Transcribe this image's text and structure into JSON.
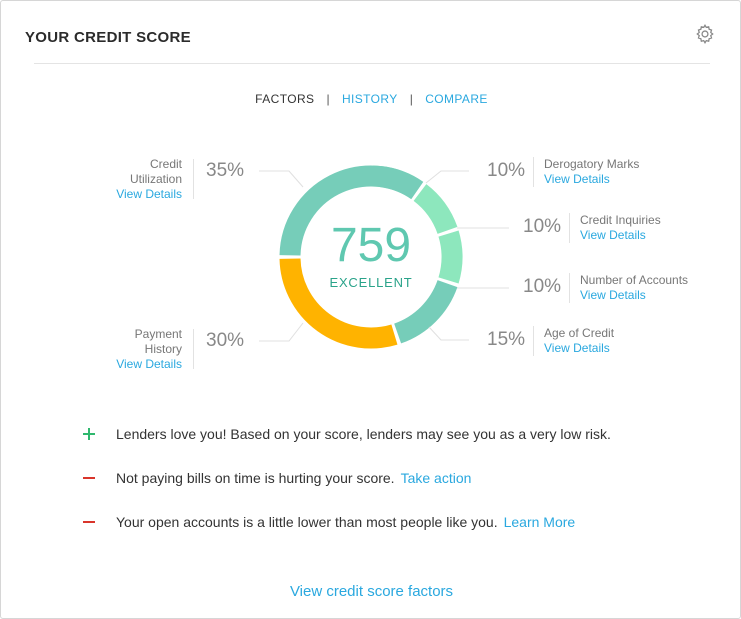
{
  "header": {
    "title": "YOUR CREDIT SCORE",
    "settings_icon": "gear-icon"
  },
  "tabs": [
    {
      "label": "FACTORS",
      "active": true
    },
    {
      "label": "HISTORY",
      "active": false
    },
    {
      "label": "COMPARE",
      "active": false
    }
  ],
  "tab_separator": "|",
  "score": {
    "value": "759",
    "rating": "EXCELLENT"
  },
  "colors": {
    "accent": "#2aa8df",
    "teal": "#76cdb9",
    "light_green": "#8de7bd",
    "orange": "#ffb300",
    "positive": "#2fb86e",
    "negative": "#d9352b"
  },
  "factors": [
    {
      "label_line1": "Credit",
      "label_line2": "Utilization",
      "percent": "35%",
      "link": "View Details",
      "color": "#76cdb9"
    },
    {
      "label_line1": "Payment",
      "label_line2": "History",
      "percent": "30%",
      "link": "View Details",
      "color": "#ffb300"
    },
    {
      "label": "Derogatory Marks",
      "percent": "10%",
      "link": "View Details",
      "color": "#8de7bd"
    },
    {
      "label": "Credit Inquiries",
      "percent": "10%",
      "link": "View Details",
      "color": "#8de7bd"
    },
    {
      "label": "Number of Accounts",
      "percent": "10%",
      "link": "View Details",
      "color": "#8de7bd"
    },
    {
      "label": "Age of Credit",
      "percent": "15%",
      "link": "View Details",
      "color": "#76cdb9"
    }
  ],
  "tips": [
    {
      "type": "positive",
      "icon": "plus-icon",
      "text": "Lenders love you!  Based on your score, lenders may see you as a very low risk.",
      "link": ""
    },
    {
      "type": "negative",
      "icon": "minus-icon",
      "text": "Not paying bills on time is hurting your score.",
      "link": "Take action"
    },
    {
      "type": "negative",
      "icon": "minus-icon",
      "text": "Your open accounts is a little lower than most people like you.",
      "link": "Learn More"
    }
  ],
  "footer": {
    "link": "View credit score factors"
  }
}
